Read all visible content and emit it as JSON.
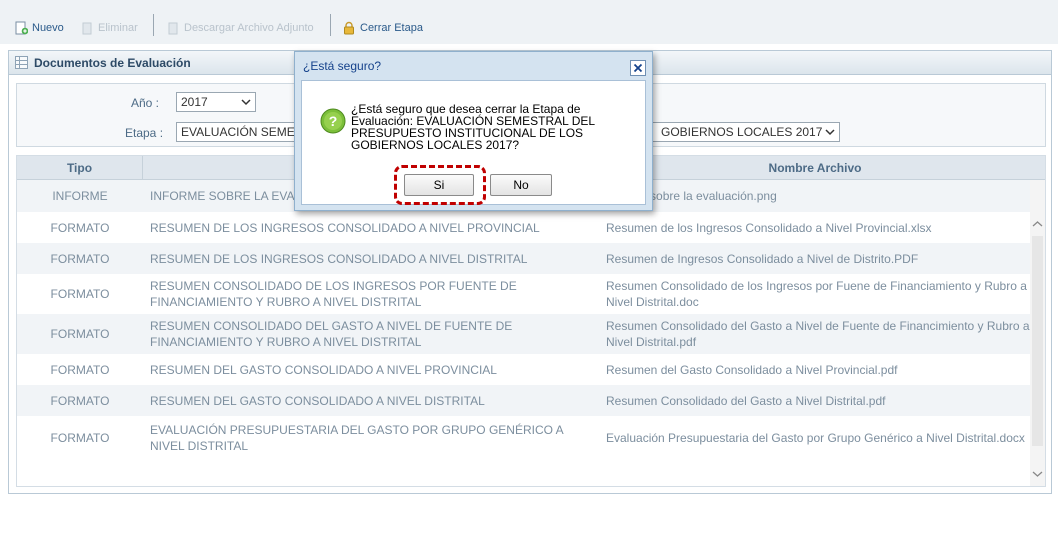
{
  "toolbar": {
    "nuevo": "Nuevo",
    "eliminar": "Eliminar",
    "descargar": "Descargar Archivo Adjunto",
    "cerrar_etapa": "Cerrar Etapa"
  },
  "panel": {
    "title": "Documentos de Evaluación",
    "filters": {
      "anio_label": "Año :",
      "anio_value": "2017",
      "etapa_label": "Etapa :",
      "etapa_value_left": "EVALUACIÓN SEMESTRAL DEL PRESUPUESTO INSTITUCIONAL DE LOS",
      "etapa_value_right": "GOBIERNOS LOCALES 2017"
    }
  },
  "table": {
    "headers": {
      "tipo": "Tipo",
      "descripcion": "",
      "archivo": "Nombre Archivo"
    },
    "rows": [
      {
        "tipo": "INFORME",
        "descripcion": "INFORME SOBRE LA EVALUACIÓN",
        "archivo": "Informe sobre la evaluación.png"
      },
      {
        "tipo": "FORMATO",
        "descripcion": "RESUMEN DE LOS INGRESOS CONSOLIDADO A NIVEL PROVINCIAL",
        "archivo": "Resumen de los Ingresos Consolidado a Nivel Provincial.xlsx"
      },
      {
        "tipo": "FORMATO",
        "descripcion": "RESUMEN DE LOS INGRESOS CONSOLIDADO A NIVEL DISTRITAL",
        "archivo": "Resumen de Ingresos Consolidado a Nivel de Distrito.PDF"
      },
      {
        "tipo": "FORMATO",
        "descripcion": "RESUMEN CONSOLIDADO DE LOS INGRESOS POR FUENTE DE FINANCIAMIENTO Y RUBRO A NIVEL DISTRITAL",
        "archivo": "Resumen Consolidado de los Ingresos por Fuene de Financiamiento y Rubro a Nivel Distrital.doc"
      },
      {
        "tipo": "FORMATO",
        "descripcion": "RESUMEN CONSOLIDADO DEL GASTO A NIVEL DE FUENTE DE FINANCIAMIENTO Y RUBRO A NIVEL DISTRITAL",
        "archivo": "Resumen Consolidado del Gasto a Nivel de Fuente de Financimiento y Rubro a Nivel Distrital.pdf"
      },
      {
        "tipo": "FORMATO",
        "descripcion": "RESUMEN DEL GASTO CONSOLIDADO A NIVEL PROVINCIAL",
        "archivo": "Resumen del Gasto Consolidado a Nivel Provincial.pdf"
      },
      {
        "tipo": "FORMATO",
        "descripcion": "RESUMEN DEL GASTO CONSOLIDADO A NIVEL DISTRITAL",
        "archivo": "Resumen Consolidado del Gasto a Nivel Distrital.pdf"
      },
      {
        "tipo": "FORMATO",
        "descripcion": "EVALUACIÓN PRESUPUESTARIA DEL GASTO POR GRUPO GENÉRICO A NIVEL DISTRITAL",
        "archivo": "Evaluación Presupuestaria del Gasto por Grupo Genérico a Nivel Distrital.docx"
      }
    ]
  },
  "dialog": {
    "title": "¿Está seguro?",
    "message": "¿Está seguro que desea cerrar la Etapa de Evaluación: EVALUACIÓN SEMESTRAL DEL PRESUPUESTO INSTITUCIONAL DE LOS GOBIERNOS LOCALES 2017?",
    "yes_label": "Si",
    "no_label": "No"
  },
  "colors": {
    "highlight": "#c00000",
    "header_text": "#15428b"
  }
}
